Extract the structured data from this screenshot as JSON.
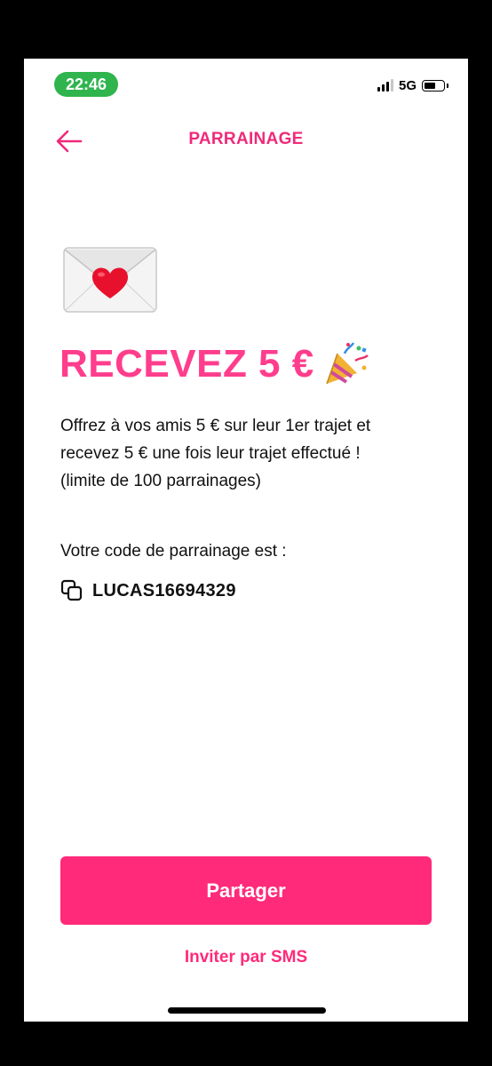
{
  "status_bar": {
    "time": "22:46",
    "network": "5G",
    "time_pill_color": "#2fb44e"
  },
  "header": {
    "title": "PARRAINAGE",
    "back_icon": "arrow-left-icon"
  },
  "hero": {
    "envelope_icon": "love-letter-emoji",
    "headline": "RECEVEZ 5 €",
    "party_icon": "party-popper-emoji",
    "description_line1": "Offrez à vos amis 5 € sur leur 1er trajet et",
    "description_line2": "recevez 5 € une fois leur trajet effectué !",
    "description_line3": "(limite de 100 parrainages)"
  },
  "referral": {
    "label": "Votre code de parrainage est :",
    "code": "LUCAS16694329",
    "copy_icon": "copy-icon"
  },
  "actions": {
    "share_label": "Partager",
    "sms_label": "Inviter par SMS"
  },
  "colors": {
    "accent": "#ff2a7a",
    "headline": "#ff3d8d",
    "text": "#111111"
  }
}
